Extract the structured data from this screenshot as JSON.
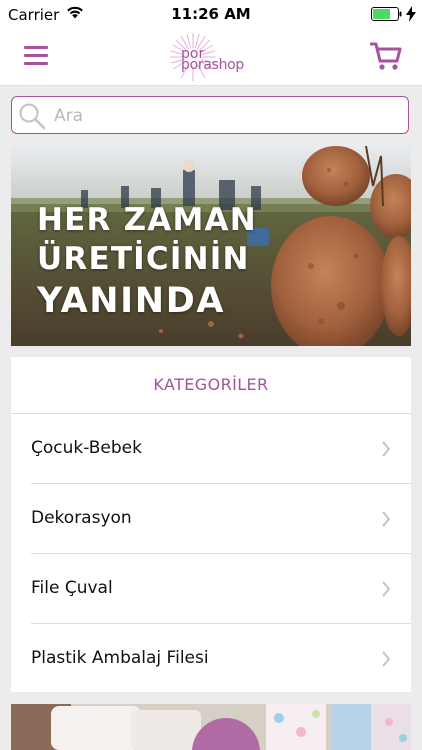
{
  "status_bar": {
    "carrier": "Carrier",
    "time": "11:26 AM",
    "icons": [
      "wifi-icon",
      "battery-icon",
      "charging-bolt-icon"
    ]
  },
  "navbar": {
    "logo_top": "por",
    "logo_bottom": "porashop",
    "icons": [
      "hamburger-menu-icon",
      "shopping-cart-icon"
    ]
  },
  "search": {
    "placeholder": "Ara",
    "value": "",
    "icon": "search-icon"
  },
  "banner": {
    "line1": "HER ZAMAN",
    "line2": "ÜRETİCİNİN",
    "line3": "YANINDA"
  },
  "categories": {
    "title": "KATEGORİLER",
    "items": [
      {
        "label": "Çocuk-Bebek"
      },
      {
        "label": "Dekorasyon"
      },
      {
        "label": "File Çuval"
      },
      {
        "label": "Plastik Ambalaj Filesi"
      }
    ]
  },
  "colors": {
    "accent": "#a6539e",
    "battery_green": "#4cd964",
    "background": "#ececec"
  }
}
